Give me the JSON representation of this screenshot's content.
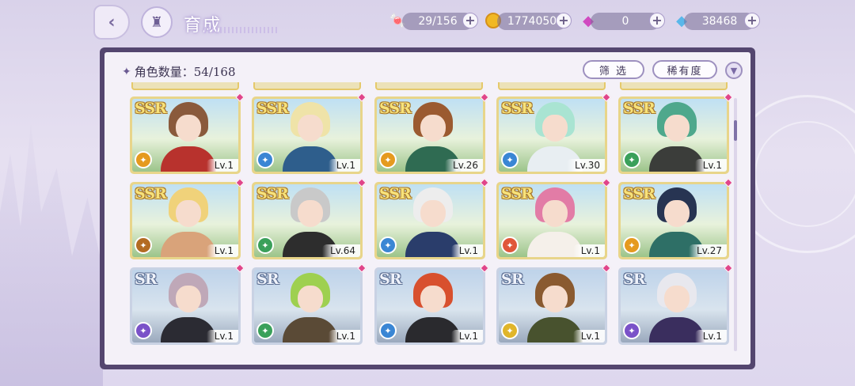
{
  "header": {
    "title": "育成",
    "back_icon": "back-arrow-icon",
    "home_icon": "castle-home-icon"
  },
  "resources": [
    {
      "name": "candy",
      "value": "29/156",
      "icon": "candy-icon",
      "color": "#e0507a"
    },
    {
      "name": "coin",
      "value": "1774050",
      "icon": "coin-icon",
      "color": "#f1b824"
    },
    {
      "name": "pink-gem",
      "value": "0",
      "icon": "pink-diamond-icon",
      "color": "#d04ac0"
    },
    {
      "name": "blue-gem",
      "value": "38468",
      "icon": "blue-diamond-icon",
      "color": "#59b7ea"
    }
  ],
  "panel": {
    "count_label": "角色数量：54/168",
    "filter_label": "筛 选",
    "rarity_label": "稀有度",
    "sort_icon": "chevron-down-icon"
  },
  "colors": {
    "panel_frame": "#54466f",
    "ssr_border": "#e8d58a",
    "sr_border": "#c9d2e4",
    "badge_pink": "#e0458a"
  },
  "cards": [
    {
      "rarity": "SSR",
      "level": "Lv.1",
      "element": "orange",
      "element_color": "#e59a1f",
      "hair": "#8a5a3c",
      "outfit": "#b8322d"
    },
    {
      "rarity": "SSR",
      "level": "Lv.1",
      "element": "blue",
      "element_color": "#3a86d4",
      "hair": "#efe3a8",
      "outfit": "#2e5e8c"
    },
    {
      "rarity": "SSR",
      "level": "Lv.26",
      "element": "orange",
      "element_color": "#e59a1f",
      "hair": "#9b5a30",
      "outfit": "#2f6b52"
    },
    {
      "rarity": "SSR",
      "level": "Lv.30",
      "element": "blue",
      "element_color": "#3a86d4",
      "hair": "#a9e4d2",
      "outfit": "#e8eef2"
    },
    {
      "rarity": "SSR",
      "level": "Lv.1",
      "element": "green",
      "element_color": "#3aa05a",
      "hair": "#4ea88c",
      "outfit": "#3b3d3a"
    },
    {
      "rarity": "SSR",
      "level": "Lv.1",
      "element": "brown",
      "element_color": "#b36b22",
      "hair": "#f0d27a",
      "outfit": "#d9a37a"
    },
    {
      "rarity": "SSR",
      "level": "Lv.64",
      "element": "green",
      "element_color": "#3aa05a",
      "hair": "#c9c9c9",
      "outfit": "#2d2d2d"
    },
    {
      "rarity": "SSR",
      "level": "Lv.1",
      "element": "blue",
      "element_color": "#3a86d4",
      "hair": "#ededed",
      "outfit": "#2a3d6b"
    },
    {
      "rarity": "SSR",
      "level": "Lv.1",
      "element": "red",
      "element_color": "#e0573a",
      "hair": "#e27ca6",
      "outfit": "#f5f0ea"
    },
    {
      "rarity": "SSR",
      "level": "Lv.27",
      "element": "orange",
      "element_color": "#e59a1f",
      "hair": "#273452",
      "outfit": "#2e6f66"
    },
    {
      "rarity": "SR",
      "level": "Lv.1",
      "element": "purple",
      "element_color": "#7a52c8",
      "hair": "#bfa8b8",
      "outfit": "#2b2b33"
    },
    {
      "rarity": "SR",
      "level": "Lv.1",
      "element": "green",
      "element_color": "#3aa05a",
      "hair": "#9ed050",
      "outfit": "#5a4a36"
    },
    {
      "rarity": "SR",
      "level": "Lv.1",
      "element": "blue",
      "element_color": "#3a86d4",
      "hair": "#d8502e",
      "outfit": "#2a2a2e"
    },
    {
      "rarity": "SR",
      "level": "Lv.1",
      "element": "yellow",
      "element_color": "#e0b52a",
      "hair": "#8a5a30",
      "outfit": "#48522e"
    },
    {
      "rarity": "SR",
      "level": "Lv.1",
      "element": "purple",
      "element_color": "#7a52c8",
      "hair": "#e8e8ee",
      "outfit": "#3a2e5e"
    }
  ]
}
